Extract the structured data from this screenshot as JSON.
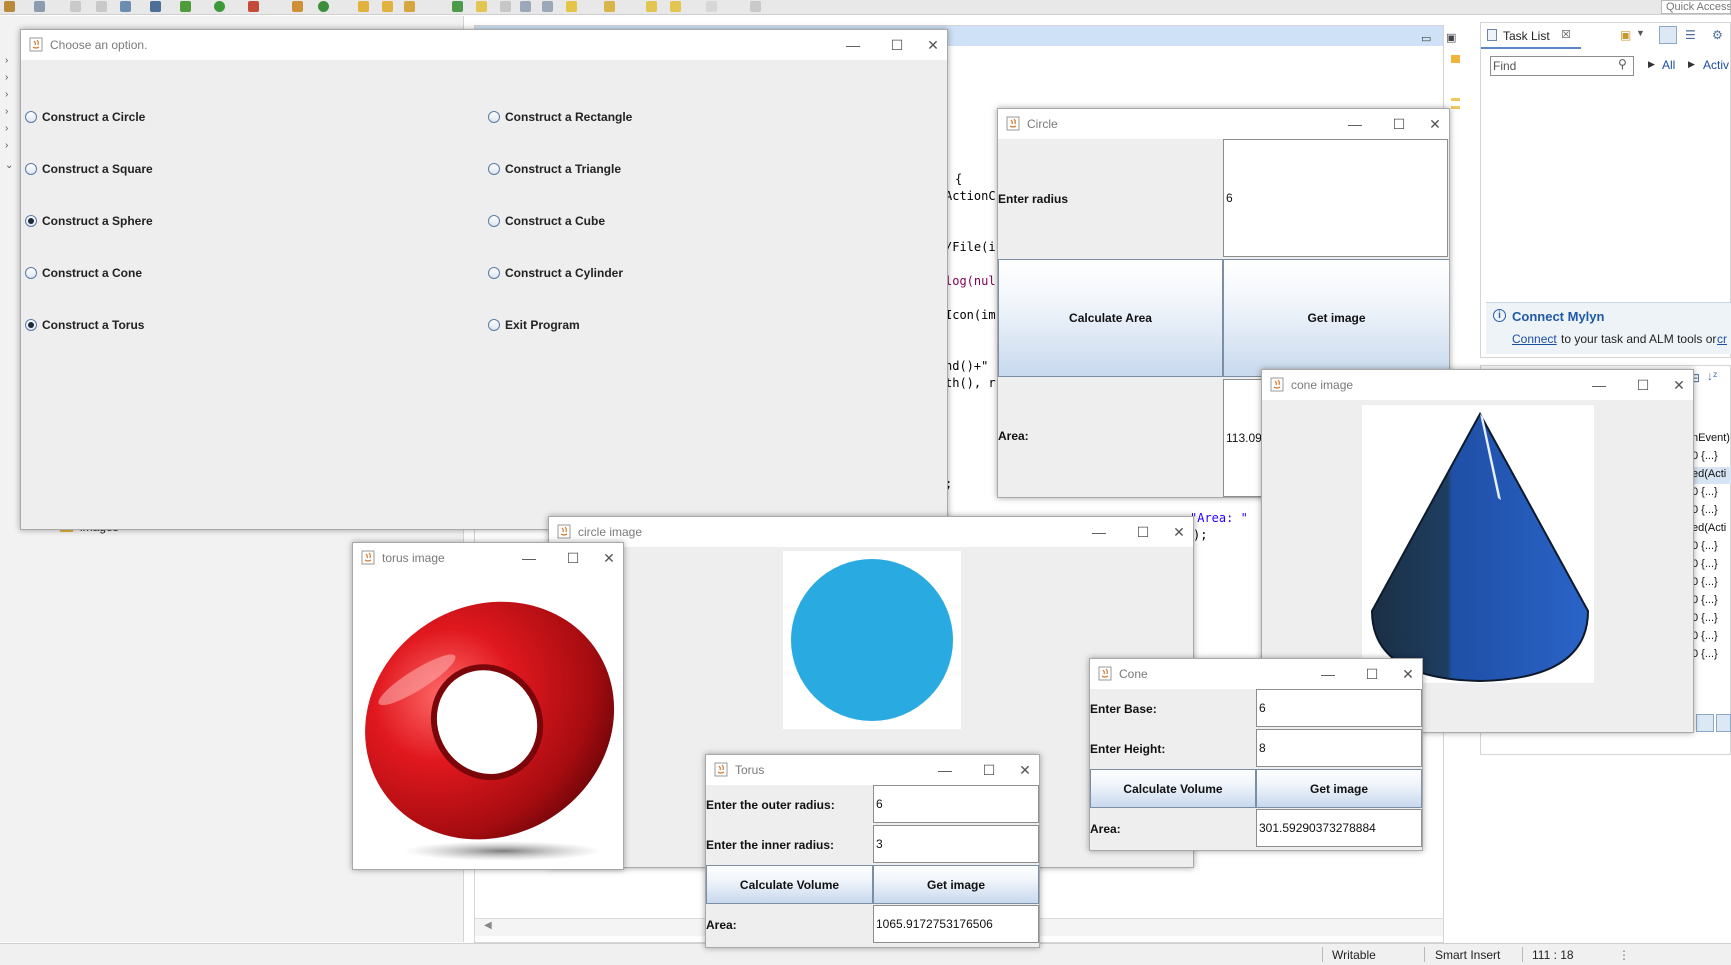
{
  "ide": {
    "quick_access": "Quick Access",
    "task_list": {
      "tab_label": "Task List",
      "find_placeholder": "Find",
      "filter_all": "All",
      "filter_active": "Activ"
    },
    "mylyn": {
      "title": "Connect Mylyn",
      "link": "Connect",
      "text": "to your task and ALM tools or",
      "link2": "cr"
    },
    "tree_item": "images",
    "code_lines": [
      "{",
      "ActionC",
      "/File(i",
      "log(nul",
      "Icon(im",
      "nd()+\"",
      "th(), r",
      ";"
    ],
    "code_area_string": "\"Area: \"",
    "code_end": ");",
    "outline_items": [
      "nEvent)",
      "0 {...}",
      "ed(Acti",
      "0 {...}",
      "0 {...}",
      "ed(Acti",
      "0 {...}",
      "0 {...}",
      "0 {...}",
      "0 {...}",
      "0 {...}",
      "0 {...}",
      "0 {...}"
    ],
    "status": {
      "mode": "Writable",
      "insert": "Smart Insert",
      "position": "111 : 18"
    }
  },
  "menu_window": {
    "title": "Choose an option.",
    "options": [
      {
        "label": "Construct a Circle",
        "checked": false
      },
      {
        "label": "Construct a Rectangle",
        "checked": false
      },
      {
        "label": "Construct a Square",
        "checked": false
      },
      {
        "label": "Construct a Triangle",
        "checked": false
      },
      {
        "label": "Construct a Sphere",
        "checked": false
      },
      {
        "label": "Construct a Cube",
        "checked": false
      },
      {
        "label": "Construct a Cone",
        "checked": false
      },
      {
        "label": "Construct a Cylinder",
        "checked": false
      },
      {
        "label": "Construct a Torus",
        "checked": true
      },
      {
        "label": "Exit Program",
        "checked": false
      }
    ]
  },
  "circle_window": {
    "title": "Circle",
    "radius_label": "Enter radius",
    "radius_value": "6",
    "calc_button": "Calculate Area",
    "image_button": "Get image",
    "area_label": "Area:",
    "area_value": "113.09"
  },
  "cone_image_window": {
    "title": "cone image"
  },
  "circle_image_window": {
    "title": "circle image",
    "circle_color": "#29abe2"
  },
  "torus_image_window": {
    "title": "torus image",
    "torus_color": "#d9161c"
  },
  "cone_window": {
    "title": "Cone",
    "base_label": "Enter Base:",
    "base_value": "6",
    "height_label": "Enter Height:",
    "height_value": "8",
    "calc_button": "Calculate Volume",
    "image_button": "Get image",
    "area_label": "Area:",
    "area_value": "301.59290373278884"
  },
  "torus_window": {
    "title": "Torus",
    "outer_label": "Enter the outer radius:",
    "outer_value": "6",
    "inner_label": "Enter the inner radius:",
    "inner_value": "3",
    "calc_button": "Calculate Volume",
    "image_button": "Get image",
    "area_label": "Area:",
    "area_value": "1065.9172753176506"
  },
  "window_controls": {
    "minimize": "—",
    "maximize": "☐",
    "close": "✕"
  }
}
